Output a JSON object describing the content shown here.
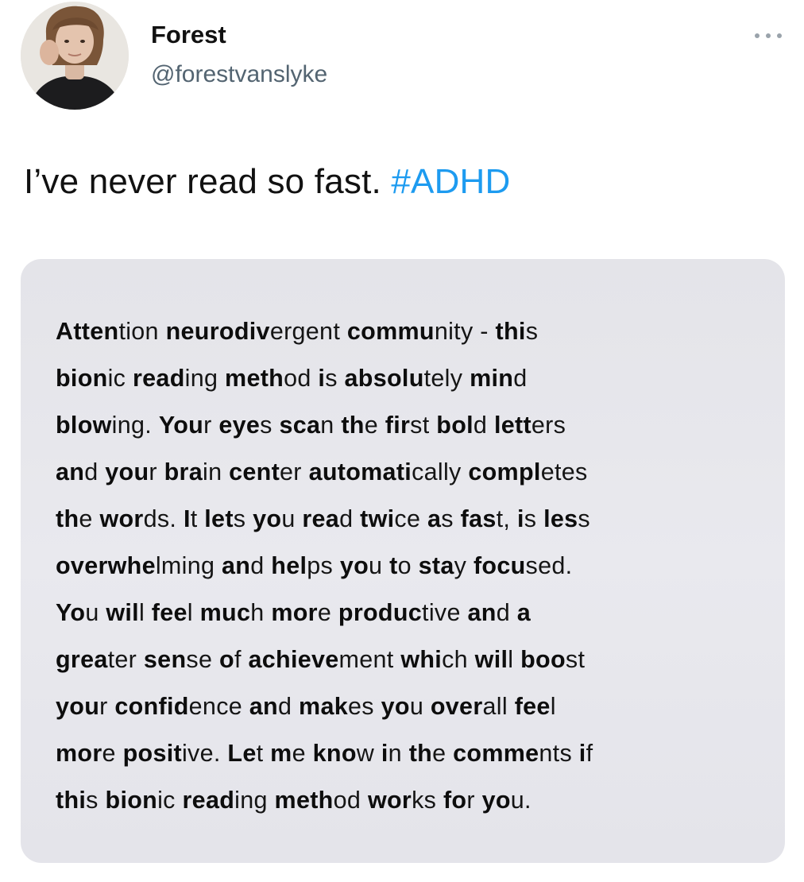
{
  "author": {
    "name": "Forest",
    "handle": "@forestvanslyke"
  },
  "icons": {
    "avatar": "profile-photo",
    "more": "more-options-icon"
  },
  "tweet": {
    "text": "I’ve never read so fast.",
    "hashtag": "#ADHD"
  },
  "image_text": {
    "lines": [
      "Attention neurodivergent community - this",
      "bionic reading method is absolutely mind",
      "blowing. Your eyes scan the first bold letters",
      "and your brain center automatically completes",
      "the words. It lets you read twice as fast, is less",
      "overwhelming and helps you to stay focused.",
      "You will feel much more productive and a",
      "greater sense of achievement which will boost",
      "your confidence and makes you overall feel",
      "more positive. Let me know in the comments if",
      "this bionic reading method works for you."
    ]
  },
  "colors": {
    "hashtag": "#1d9bf0",
    "handle": "#536471",
    "card_background": "#e7e7ec"
  }
}
